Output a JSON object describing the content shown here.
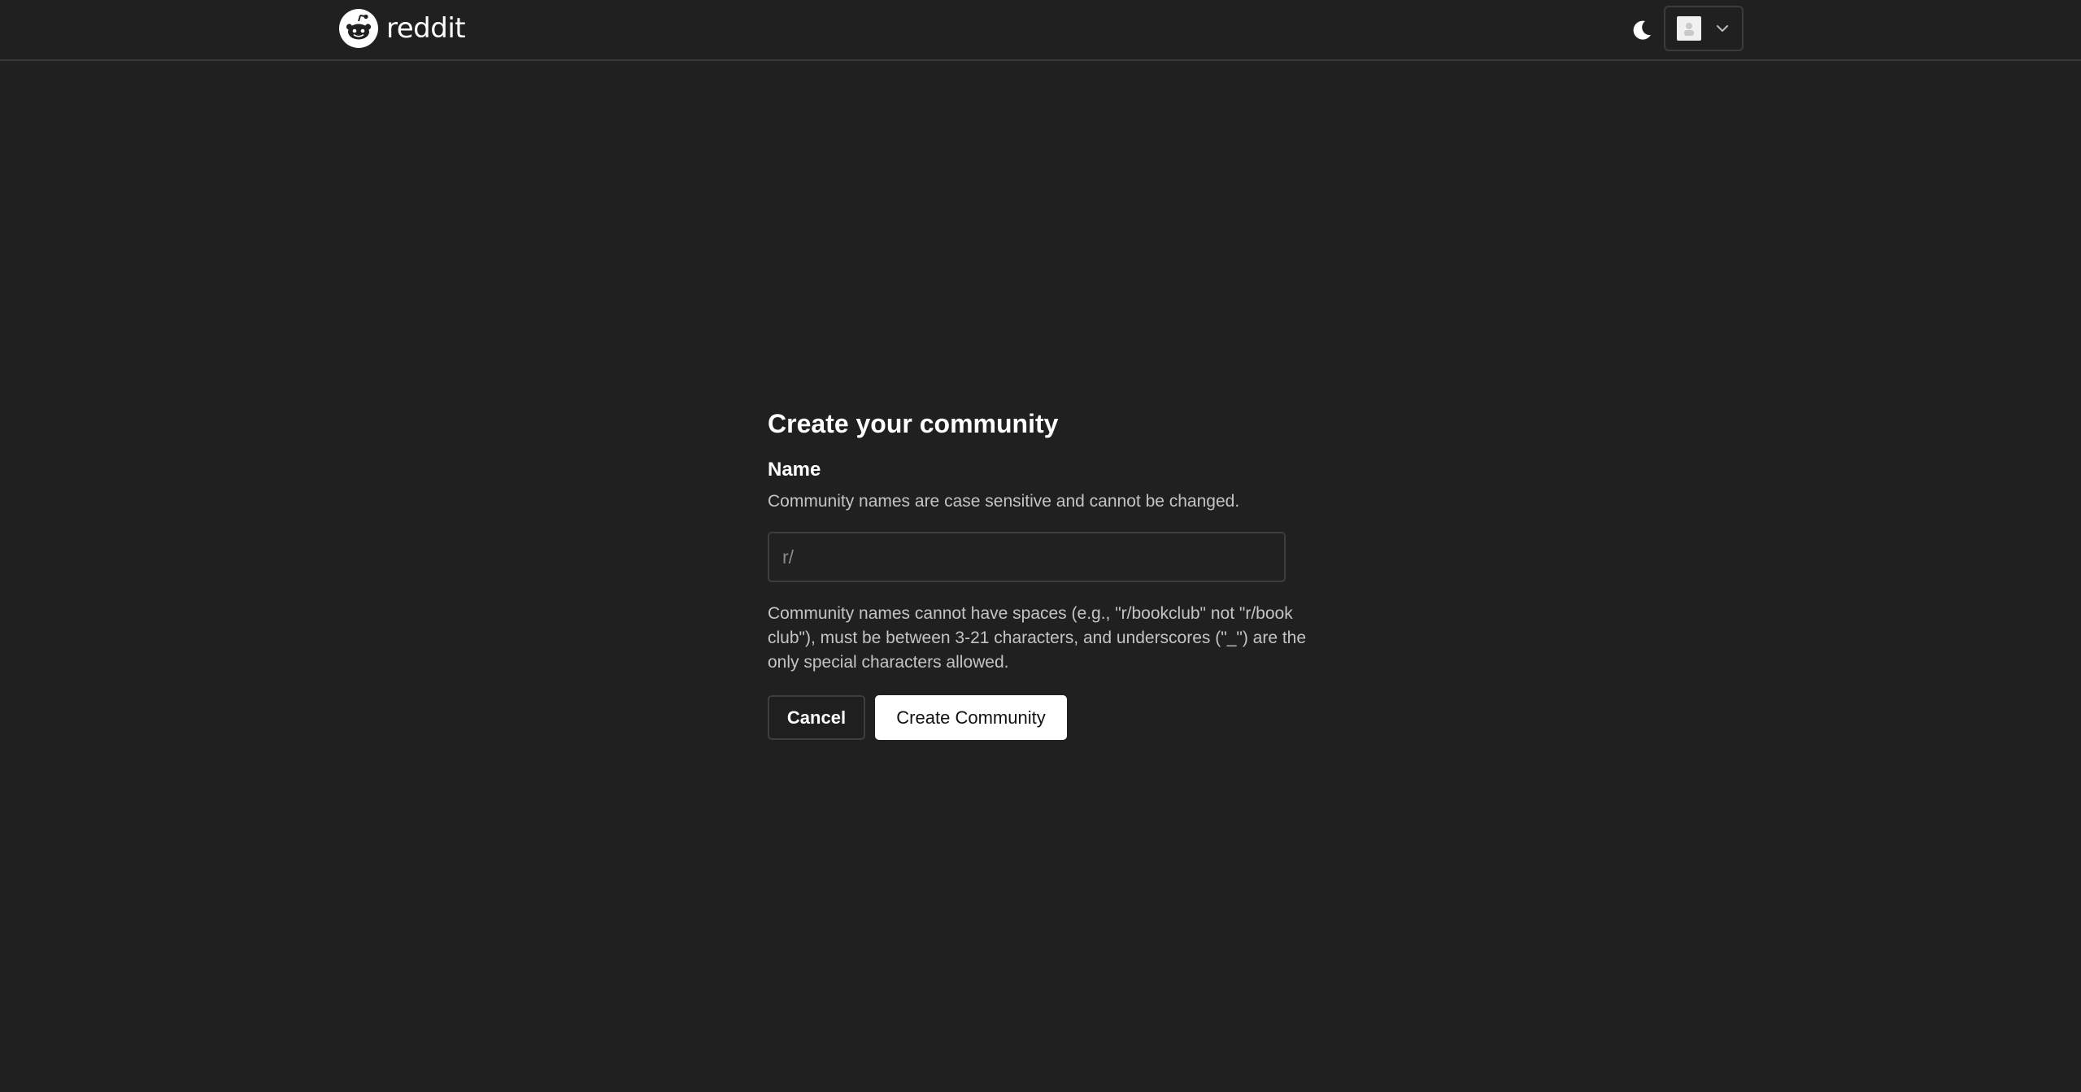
{
  "header": {
    "logo_text": "reddit",
    "theme_toggle_icon": "moon-icon",
    "user_menu": {
      "avatar_icon": "avatar-icon",
      "chevron_icon": "chevron-down-icon"
    }
  },
  "form": {
    "title": "Create your community",
    "name_label": "Name",
    "name_help": "Community names are case sensitive and cannot be changed.",
    "name_input": {
      "value": "",
      "placeholder": "r/"
    },
    "rules": "Community names cannot have spaces (e.g., \"r/bookclub\" not \"r/book club\"), must be between 3-21 characters, and underscores (\"_\") are the only special characters allowed.",
    "cancel_label": "Cancel",
    "create_label": "Create Community"
  },
  "colors": {
    "background": "#202020",
    "text": "#ffffff",
    "muted_text": "#c4c4c4",
    "border": "#3e3e3e",
    "primary_button_bg": "#ffffff",
    "primary_button_text": "#111111"
  }
}
